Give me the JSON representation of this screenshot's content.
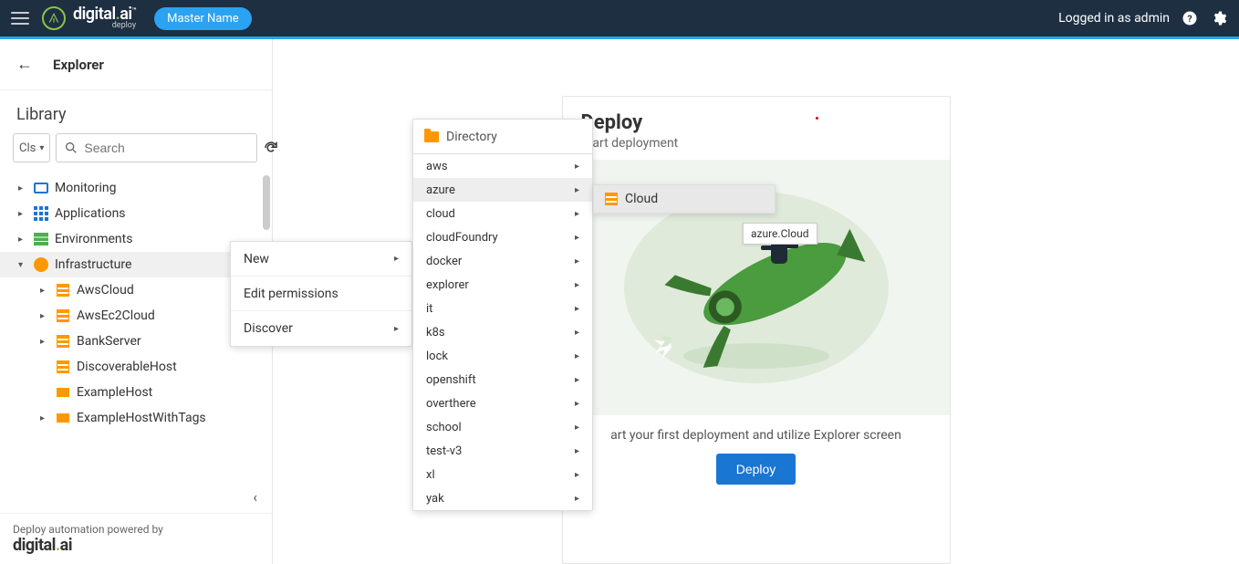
{
  "topbar": {
    "master_badge": "Master Name",
    "logged_in_text": "Logged in as admin"
  },
  "sidebar": {
    "explorer_title": "Explorer",
    "library_title": "Library",
    "cls_label": "Cls",
    "search_placeholder": "Search",
    "tree": {
      "monitoring": "Monitoring",
      "applications": "Applications",
      "environments": "Environments",
      "infrastructure": "Infrastructure",
      "children": [
        "AwsCloud",
        "AwsEc2Cloud",
        "BankServer",
        "DiscoverableHost",
        "ExampleHost",
        "ExampleHostWithTags"
      ]
    },
    "footer_text": "Deploy automation powered by"
  },
  "context_menu_1": {
    "new": "New",
    "edit_permissions": "Edit permissions",
    "discover": "Discover"
  },
  "context_menu_2": {
    "header": "Directory",
    "items": [
      "aws",
      "azure",
      "cloud",
      "cloudFoundry",
      "docker",
      "explorer",
      "it",
      "k8s",
      "lock",
      "openshift",
      "overthere",
      "school",
      "test-v3",
      "xl",
      "yak"
    ]
  },
  "context_menu_3": {
    "cloud": "Cloud"
  },
  "tooltip": "azure.Cloud",
  "card": {
    "title": "Deploy",
    "subtitle": "Start deployment",
    "footer_text": "art your first deployment and utilize Explorer screen",
    "button": "Deploy"
  }
}
